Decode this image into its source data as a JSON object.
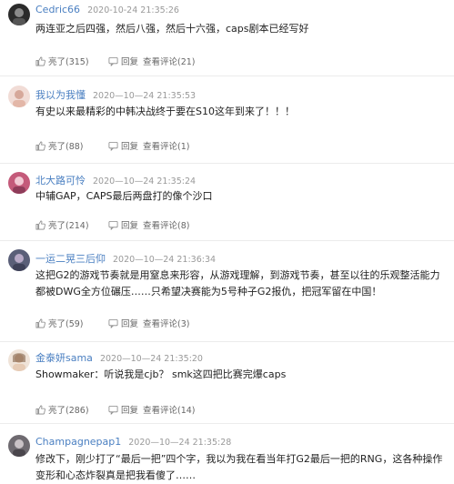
{
  "comments": [
    {
      "user": "Cedric66",
      "time": "2020-10-24 21:35:26",
      "text": "两连亚之后四强，然后八强，然后十六强，caps剧本已经写好",
      "likes": "亮了(315)",
      "reply": "回复",
      "view": "查看评论(21)",
      "avatar_color": "#2b2b2b"
    },
    {
      "user": "我以为我懂",
      "time": "2020—10—24 21:35:53",
      "text": "有史以来最精彩的中韩决战终于要在S10这年到来了！！！",
      "likes": "亮了(88)",
      "reply": "回复",
      "view": "查看评论(1)",
      "avatar_color": "#e9cfc8"
    },
    {
      "user": "北大路可怜",
      "time": "2020—10—24 21:35:24",
      "text": "中辅GAP，CAPS最后两盘打的像个沙口",
      "likes": "亮了(214)",
      "reply": "回复",
      "view": "查看评论(8)",
      "avatar_color": "#c45a7a"
    },
    {
      "user": "一运二晃三后仰",
      "time": "2020—10—24 21:36:34",
      "text": "这把G2的游戏节奏就是用窒息来形容，从游戏理解，到游戏节奏，甚至以往的乐观整活能力都被DWG全方位碾压……只希望决赛能为5号种子G2报仇，把冠军留在中国！",
      "likes": "亮了(59)",
      "reply": "回复",
      "view": "查看评论(3)",
      "avatar_color": "#5a5f78"
    },
    {
      "user": "金泰妍sama",
      "time": "2020—10—24 21:35:20",
      "text": "Showmaker：听说我是cjb？ smk这四把比赛完爆caps",
      "likes": "亮了(286)",
      "reply": "回复",
      "view": "查看评论(14)",
      "avatar_color": "#d9b9a0"
    },
    {
      "user": "Champagnepap1",
      "time": "2020—10—24 21:35:28",
      "text": "修改下，刚少打了“最后一把”四个字，我以为我在看当年打G2最后一把的RNG，这各种操作变形和心态炸裂真是把我看傻了……",
      "likes": "",
      "reply": "",
      "view": "",
      "avatar_color": "#6e6a70"
    }
  ]
}
